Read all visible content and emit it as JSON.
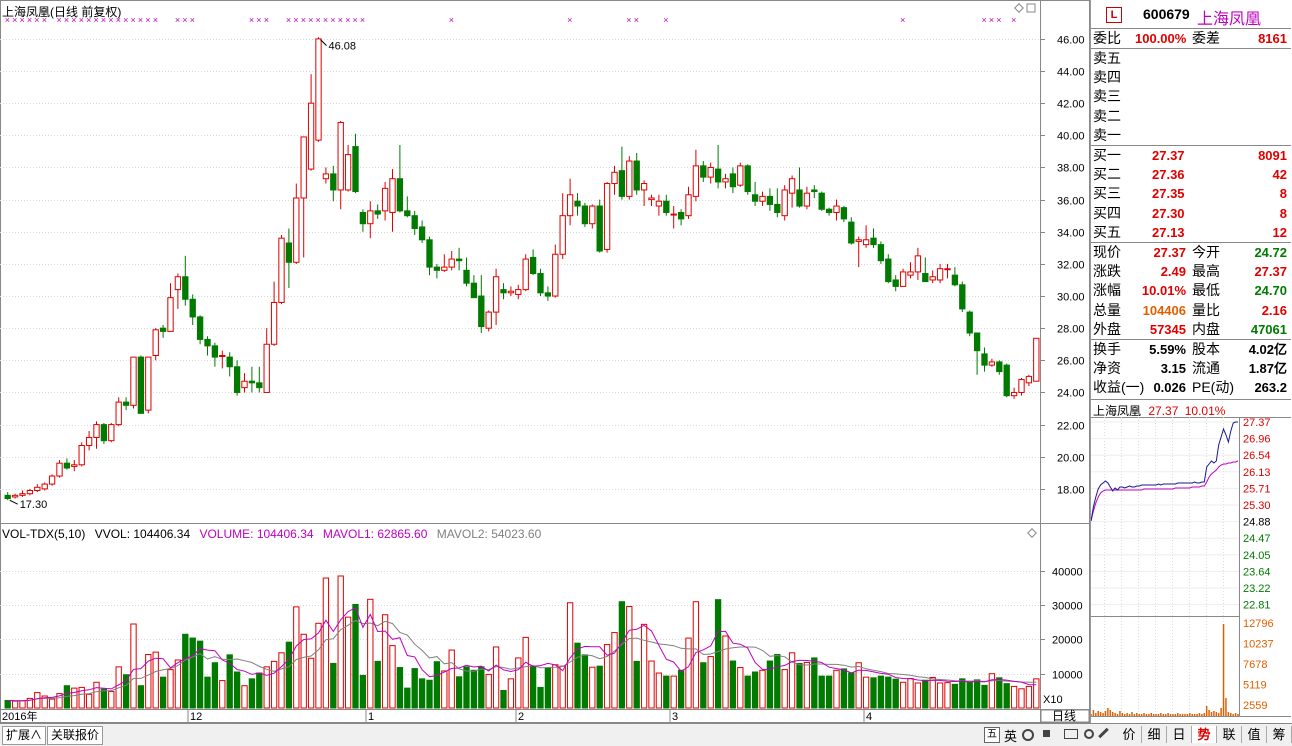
{
  "chart_header": "上海凤凰(日线 前复权)",
  "high_label": "46.08",
  "low_label": "17.30",
  "price_axis": [
    "46.00",
    "44.00",
    "42.00",
    "40.00",
    "38.00",
    "36.00",
    "34.00",
    "32.00",
    "30.00",
    "28.00",
    "26.00",
    "24.00",
    "22.00",
    "20.00",
    "18.00"
  ],
  "vol_axis": [
    "40000",
    "30000",
    "20000",
    "10000"
  ],
  "vol_axis_unit": "X10",
  "x_axis": [
    "2016年",
    "12",
    "1",
    "2",
    "3",
    "4"
  ],
  "period_label": "日线",
  "vol_header": {
    "name": "VOL-TDX(5,10)",
    "vvol": "VVOL: 104406.34",
    "volume": "VOLUME: 104406.34",
    "mavol1": "MAVOL1: 62865.60",
    "mavol2": "MAVOL2: 54023.60"
  },
  "colors": {
    "up": "#e00000",
    "down": "#007a00",
    "ma1": "#c000c0",
    "ma2": "#808080",
    "cross": "#c000c0"
  },
  "chart_data": {
    "type": "candlestick",
    "title": "上海凤凰(日线 前复权)",
    "ylim": [
      17,
      47
    ],
    "candles": [
      [
        17.6,
        17.4,
        17.8,
        17.3
      ],
      [
        17.5,
        17.6,
        17.7,
        17.4
      ],
      [
        17.6,
        17.7,
        17.9,
        17.5
      ],
      [
        17.7,
        17.9,
        18.0,
        17.6
      ],
      [
        17.9,
        18.1,
        18.3,
        17.8
      ],
      [
        18.0,
        18.3,
        18.4,
        17.9
      ],
      [
        18.3,
        18.8,
        18.9,
        18.2
      ],
      [
        18.8,
        19.6,
        19.8,
        18.7
      ],
      [
        19.6,
        19.3,
        19.9,
        19.2
      ],
      [
        19.4,
        19.5,
        19.8,
        19.1
      ],
      [
        19.5,
        20.7,
        20.9,
        19.4
      ],
      [
        20.7,
        21.2,
        21.6,
        20.4
      ],
      [
        21.2,
        22.0,
        22.2,
        20.5
      ],
      [
        22.0,
        21.0,
        22.1,
        20.8
      ],
      [
        21.0,
        22.0,
        22.1,
        20.9
      ],
      [
        22.0,
        23.4,
        23.7,
        21.9
      ],
      [
        23.4,
        23.2,
        23.7,
        22.9
      ],
      [
        23.2,
        26.2,
        26.2,
        23.0
      ],
      [
        26.2,
        22.7,
        26.3,
        22.7
      ],
      [
        22.9,
        26.2,
        26.2,
        22.7
      ],
      [
        26.3,
        27.9,
        28.0,
        26.0
      ],
      [
        28.0,
        27.8,
        28.2,
        27.4
      ],
      [
        27.8,
        29.9,
        30.8,
        27.9
      ],
      [
        30.4,
        31.2,
        31.4,
        29.2
      ],
      [
        31.2,
        29.8,
        32.5,
        29.4
      ],
      [
        29.8,
        28.7,
        30.1,
        28.2
      ],
      [
        28.7,
        27.3,
        28.8,
        27.0
      ],
      [
        27.3,
        26.9,
        27.5,
        26.3
      ],
      [
        26.9,
        26.2,
        27.1,
        25.6
      ],
      [
        26.3,
        26.3,
        26.6,
        25.5
      ],
      [
        26.2,
        25.6,
        26.5,
        25.0
      ],
      [
        25.6,
        24.0,
        26.0,
        23.8
      ],
      [
        24.3,
        24.7,
        25.2,
        24.0
      ],
      [
        24.7,
        24.6,
        25.6,
        24.0
      ],
      [
        24.6,
        24.3,
        25.6,
        24.0
      ],
      [
        24.0,
        27.0,
        28.0,
        24.0
      ],
      [
        27.0,
        29.6,
        30.9,
        26.9
      ],
      [
        29.6,
        33.6,
        33.8,
        29.5
      ],
      [
        33.3,
        32.1,
        34.2,
        30.5
      ],
      [
        32.1,
        36.1,
        37.0,
        32.0
      ],
      [
        36.1,
        39.9,
        39.9,
        32.4
      ],
      [
        37.9,
        42.0,
        43.8,
        37.8
      ],
      [
        39.7,
        46.0,
        46.1,
        39.6
      ],
      [
        37.3,
        37.6,
        38.0,
        37.0
      ],
      [
        37.6,
        36.6,
        38.1,
        35.9
      ],
      [
        36.6,
        40.8,
        40.9,
        35.4
      ],
      [
        36.6,
        38.8,
        39.4,
        36.5
      ],
      [
        39.3,
        36.5,
        40.1,
        36.4
      ],
      [
        35.2,
        34.5,
        35.4,
        34.0
      ],
      [
        34.5,
        35.3,
        35.9,
        33.6
      ],
      [
        35.3,
        35.1,
        35.7,
        34.8
      ],
      [
        35.3,
        36.7,
        37.1,
        34.7
      ],
      [
        35.2,
        37.3,
        37.9,
        34.0
      ],
      [
        37.3,
        35.3,
        39.4,
        35.2
      ],
      [
        35.3,
        35.0,
        36.2,
        34.9
      ],
      [
        35.0,
        34.2,
        35.3,
        33.8
      ],
      [
        34.3,
        33.5,
        34.7,
        33.3
      ],
      [
        33.5,
        31.8,
        33.7,
        31.3
      ],
      [
        31.8,
        31.6,
        32.0,
        31.1
      ],
      [
        31.6,
        31.8,
        32.6,
        31.5
      ],
      [
        31.8,
        32.3,
        32.8,
        31.6
      ],
      [
        32.3,
        32.2,
        33.0,
        31.6
      ],
      [
        31.6,
        30.8,
        32.4,
        30.6
      ],
      [
        30.8,
        29.9,
        31.3,
        29.9
      ],
      [
        30.0,
        28.1,
        31.3,
        27.7
      ],
      [
        28.0,
        29.0,
        29.1,
        27.8
      ],
      [
        29.0,
        31.2,
        31.7,
        28.2
      ],
      [
        30.4,
        30.2,
        30.8,
        29.8
      ],
      [
        30.2,
        30.3,
        30.6,
        30.0
      ],
      [
        30.1,
        30.4,
        30.7,
        29.8
      ],
      [
        30.4,
        32.3,
        32.6,
        30.3
      ],
      [
        32.4,
        31.4,
        32.9,
        31.3
      ],
      [
        31.4,
        30.2,
        31.7,
        30.0
      ],
      [
        30.2,
        30.0,
        30.6,
        29.7
      ],
      [
        30.0,
        32.6,
        33.2,
        29.9
      ],
      [
        32.6,
        35.0,
        36.4,
        32.3
      ],
      [
        35.0,
        36.3,
        37.3,
        34.4
      ],
      [
        35.9,
        35.6,
        36.4,
        35.0
      ],
      [
        35.6,
        34.5,
        35.8,
        34.3
      ],
      [
        34.5,
        35.6,
        35.7,
        34.2
      ],
      [
        35.6,
        32.8,
        36.0,
        32.7
      ],
      [
        32.9,
        37.0,
        37.1,
        32.7
      ],
      [
        37.0,
        37.7,
        38.1,
        36.3
      ],
      [
        37.8,
        36.2,
        39.3,
        36.0
      ],
      [
        36.2,
        38.4,
        38.7,
        36.0
      ],
      [
        38.4,
        36.6,
        38.9,
        36.3
      ],
      [
        36.6,
        37.0,
        37.2,
        35.6
      ],
      [
        36.0,
        36.1,
        36.3,
        35.6
      ],
      [
        35.6,
        35.9,
        36.3,
        35.0
      ],
      [
        35.9,
        35.2,
        36.3,
        35.0
      ],
      [
        35.1,
        35.1,
        35.6,
        34.2
      ],
      [
        35.2,
        34.8,
        35.4,
        34.4
      ],
      [
        35.0,
        36.3,
        36.8,
        34.8
      ],
      [
        36.2,
        38.1,
        39.1,
        35.9
      ],
      [
        38.1,
        37.4,
        38.4,
        37.1
      ],
      [
        37.4,
        38.0,
        38.3,
        37.0
      ],
      [
        37.9,
        37.1,
        39.4,
        36.7
      ],
      [
        37.1,
        37.3,
        37.6,
        36.7
      ],
      [
        37.6,
        36.8,
        38.0,
        36.4
      ],
      [
        36.9,
        38.1,
        38.3,
        36.8
      ],
      [
        38.1,
        36.5,
        38.2,
        36.3
      ],
      [
        36.3,
        35.9,
        37.1,
        35.6
      ],
      [
        35.9,
        36.2,
        36.5,
        35.6
      ],
      [
        36.2,
        35.7,
        36.7,
        35.3
      ],
      [
        35.7,
        35.2,
        36.7,
        34.9
      ],
      [
        35.0,
        36.6,
        36.9,
        34.7
      ],
      [
        36.4,
        37.3,
        37.5,
        35.5
      ],
      [
        36.6,
        35.6,
        38.0,
        35.5
      ],
      [
        35.6,
        36.4,
        36.8,
        35.4
      ],
      [
        36.6,
        36.5,
        36.9,
        36.1
      ],
      [
        36.4,
        35.4,
        36.5,
        35.3
      ],
      [
        35.4,
        35.2,
        35.5,
        35.0
      ],
      [
        35.2,
        35.6,
        36.0,
        34.7
      ],
      [
        35.5,
        34.8,
        35.6,
        34.6
      ],
      [
        34.6,
        33.3,
        34.9,
        33.2
      ],
      [
        33.4,
        33.5,
        33.7,
        31.8
      ],
      [
        33.2,
        33.5,
        34.4,
        33.0
      ],
      [
        33.6,
        33.2,
        34.2,
        33.0
      ],
      [
        33.2,
        32.2,
        33.4,
        32.0
      ],
      [
        32.3,
        30.9,
        32.6,
        30.8
      ],
      [
        31.0,
        30.6,
        31.3,
        30.3
      ],
      [
        30.6,
        31.5,
        31.7,
        30.6
      ],
      [
        31.3,
        31.5,
        32.1,
        31.1
      ],
      [
        31.5,
        32.5,
        33.0,
        31.0
      ],
      [
        31.4,
        30.9,
        32.4,
        30.9
      ],
      [
        31.0,
        31.2,
        31.6,
        30.8
      ],
      [
        31.0,
        31.7,
        32.0,
        30.8
      ],
      [
        31.7,
        31.7,
        32.0,
        31.1
      ],
      [
        31.3,
        30.7,
        31.8,
        30.6
      ],
      [
        30.7,
        29.2,
        30.9,
        29.0
      ],
      [
        29.0,
        27.7,
        29.1,
        27.5
      ],
      [
        27.7,
        26.6,
        27.7,
        25.1
      ],
      [
        26.4,
        25.7,
        26.8,
        25.3
      ],
      [
        25.7,
        25.9,
        26.1,
        25.6
      ],
      [
        25.9,
        25.3,
        26.0,
        25.1
      ],
      [
        25.7,
        23.8,
        25.8,
        23.7
      ],
      [
        23.8,
        24.0,
        24.3,
        23.6
      ],
      [
        24.0,
        24.8,
        24.9,
        23.8
      ],
      [
        24.6,
        25.0,
        25.1,
        24.4
      ],
      [
        24.7,
        27.37,
        27.37,
        24.7
      ]
    ],
    "volume": [
      2200,
      2000,
      2100,
      2800,
      4500,
      3500,
      2600,
      4200,
      6500,
      5800,
      6000,
      4000,
      7500,
      5500,
      4800,
      12000,
      9700,
      24500,
      6500,
      15600,
      16300,
      9000,
      11200,
      14000,
      21500,
      20400,
      19500,
      9000,
      13200,
      8000,
      15500,
      10500,
      6500,
      8500,
      10200,
      12000,
      13600,
      16100,
      19200,
      29500,
      21500,
      14500,
      24700,
      37900,
      13000,
      38500,
      26500,
      30200,
      9500,
      31700,
      13600,
      27200,
      18200,
      11800,
      5800,
      11500,
      8500,
      8100,
      13500,
      10800,
      16900,
      9100,
      12000,
      11000,
      12000,
      9800,
      17800,
      5100,
      8500,
      14600,
      20600,
      12200,
      6000,
      11600,
      12600,
      12200,
      30700,
      18900,
      15500,
      11900,
      12200,
      18500,
      22000,
      31000,
      29600,
      13600,
      24400,
      13700,
      10200,
      9300,
      9300,
      11000,
      20400,
      31000,
      13200,
      15000,
      31600,
      21000,
      13700,
      11800,
      9300,
      10500,
      11000,
      13700,
      15600,
      11200,
      16100,
      13000,
      13300,
      14600,
      9300,
      9300,
      11000,
      11400,
      10200,
      13200,
      9000,
      8800,
      9300,
      9000,
      8400,
      7500,
      8600,
      7300,
      8100,
      8900,
      7300,
      7400,
      6900,
      8500,
      7800,
      8200,
      6600,
      10000,
      8800,
      7100,
      6300,
      5600,
      6300,
      8500
    ]
  },
  "right_panel": {
    "logo": "L",
    "code": "600679",
    "name": "上海凤凰",
    "weibi_label": "委比",
    "weibi_value": "100.00%",
    "weicha_label": "委差",
    "weicha_value": "8161",
    "sell": [
      {
        "label": "卖五",
        "price": "",
        "vol": ""
      },
      {
        "label": "卖四",
        "price": "",
        "vol": ""
      },
      {
        "label": "卖三",
        "price": "",
        "vol": ""
      },
      {
        "label": "卖二",
        "price": "",
        "vol": ""
      },
      {
        "label": "卖一",
        "price": "",
        "vol": ""
      }
    ],
    "buy": [
      {
        "label": "买一",
        "price": "27.37",
        "vol": "8091"
      },
      {
        "label": "买二",
        "price": "27.36",
        "vol": "42"
      },
      {
        "label": "买三",
        "price": "27.35",
        "vol": "8"
      },
      {
        "label": "买四",
        "price": "27.30",
        "vol": "8"
      },
      {
        "label": "买五",
        "price": "27.13",
        "vol": "12"
      }
    ],
    "stats": [
      {
        "l1": "现价",
        "v1": "27.37",
        "c1": "red",
        "l2": "今开",
        "v2": "24.72",
        "c2": "green"
      },
      {
        "l1": "涨跌",
        "v1": "2.49",
        "c1": "red",
        "l2": "最高",
        "v2": "27.37",
        "c2": "red"
      },
      {
        "l1": "涨幅",
        "v1": "10.01%",
        "c1": "red",
        "l2": "最低",
        "v2": "24.70",
        "c2": "green"
      },
      {
        "l1": "总量",
        "v1": "104406",
        "c1": "orange",
        "l2": "量比",
        "v2": "2.16",
        "c2": "red"
      },
      {
        "l1": "外盘",
        "v1": "57345",
        "c1": "red",
        "l2": "内盘",
        "v2": "47061",
        "c2": "green"
      }
    ],
    "fin": [
      {
        "l1": "换手",
        "v1": "5.59%",
        "l2": "股本",
        "v2": "4.02亿"
      },
      {
        "l1": "净资",
        "v1": "3.15",
        "l2": "流通",
        "v2": "1.87亿"
      },
      {
        "l1": "收益(一)",
        "v1": "0.026",
        "l2": "PE(动)",
        "v2": "263.2"
      }
    ],
    "mini_title": "上海凤凰",
    "mini_price": "27.37",
    "mini_pct": "10.01%",
    "mini_price_axis": [
      "27.37",
      "26.96",
      "26.54",
      "26.13",
      "25.71",
      "25.30",
      "24.88",
      "24.47",
      "24.05",
      "23.64",
      "23.22",
      "22.81"
    ],
    "mini_vol_axis": [
      "12796",
      "10237",
      "7678",
      "5119",
      "2559"
    ]
  },
  "bottom_left_tabs": [
    "扩展∧",
    "关联报价"
  ],
  "bottom_right_tabs": [
    "价",
    "细",
    "日",
    "势",
    "联",
    "值",
    "筹"
  ],
  "bottom_icons": [
    "五",
    "英"
  ]
}
